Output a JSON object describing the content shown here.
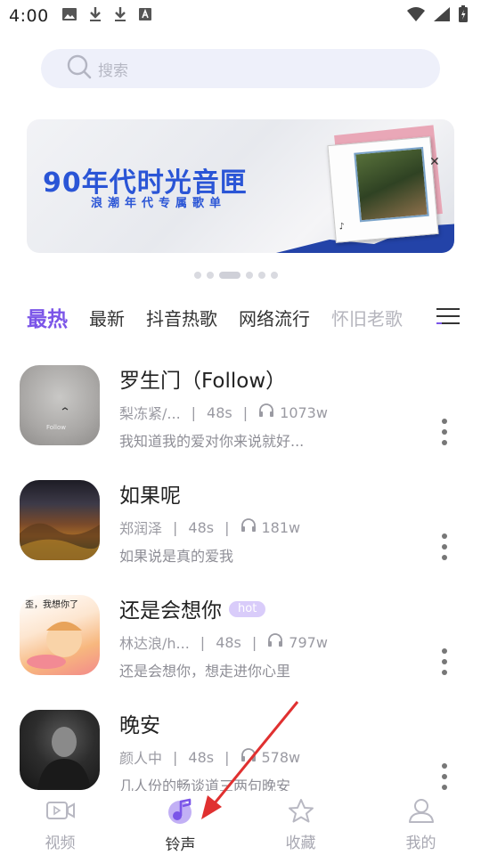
{
  "status_bar": {
    "time": "4:00"
  },
  "search": {
    "placeholder": "搜索"
  },
  "banner": {
    "title": "90年代时光音匣",
    "subtitle": "浪潮年代专属歌单"
  },
  "tabs": [
    {
      "label": "最热",
      "active": true
    },
    {
      "label": "最新",
      "active": false
    },
    {
      "label": "抖音热歌",
      "active": false
    },
    {
      "label": "网络流行",
      "active": false
    },
    {
      "label": "怀旧老歌",
      "active": false
    }
  ],
  "songs": [
    {
      "title": "罗生门（Follow）",
      "artist": "梨冻紧/...",
      "duration": "48s",
      "plays": "1073w",
      "desc": "我知道我的爱对你来说就好...",
      "hot": false
    },
    {
      "title": "如果呢",
      "artist": "郑润泽",
      "duration": "48s",
      "plays": "181w",
      "desc": "如果说是真的爱我",
      "hot": false
    },
    {
      "title": "还是会想你",
      "artist": "林达浪/h...",
      "duration": "48s",
      "plays": "797w",
      "desc": "还是会想你，想走进你心里",
      "hot": true,
      "hot_label": "hot"
    },
    {
      "title": "晚安",
      "artist": "颜人中",
      "duration": "48s",
      "plays": "578w",
      "desc": "几人份的畅谈道三两句晚安",
      "hot": false
    }
  ],
  "bottom_nav": [
    {
      "label": "视频",
      "icon": "video-icon",
      "active": false
    },
    {
      "label": "铃声",
      "icon": "music-note-icon",
      "active": true
    },
    {
      "label": "收藏",
      "icon": "star-icon",
      "active": false
    },
    {
      "label": "我的",
      "icon": "person-icon",
      "active": false
    }
  ],
  "colors": {
    "accent": "#7b55e8",
    "annotation": "#e03030"
  }
}
